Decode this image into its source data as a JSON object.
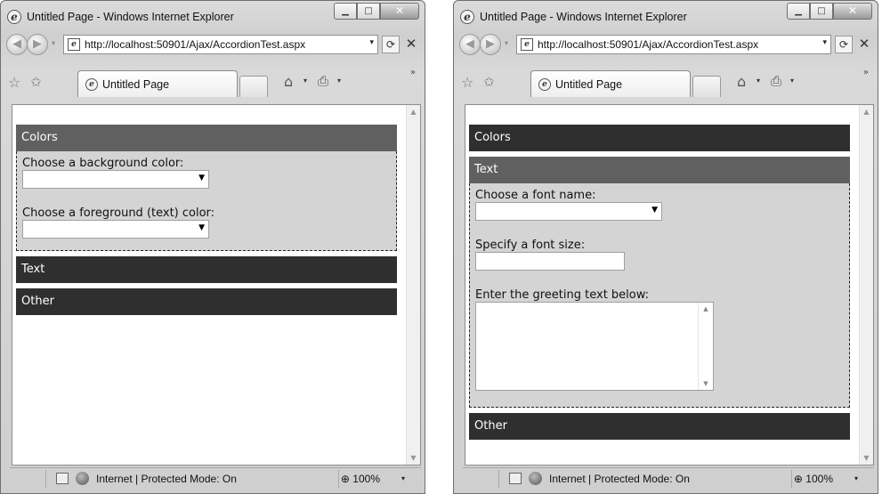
{
  "windows": [
    {
      "title": "Untitled Page - Windows Internet Explorer",
      "address": "http://localhost:50901/Ajax/AccordionTest.aspx",
      "tab_label": "Untitled Page",
      "accordion": {
        "colors_header": "Colors",
        "colors_bg_label": "Choose a background color:",
        "colors_fg_label": "Choose a foreground (text) color:",
        "text_header": "Text",
        "other_header": "Other",
        "open_pane": "Colors"
      },
      "status_text": "Internet | Protected Mode: On",
      "zoom": "100%"
    },
    {
      "title": "Untitled Page - Windows Internet Explorer",
      "address": "http://localhost:50901/Ajax/AccordionTest.aspx",
      "tab_label": "Untitled Page",
      "accordion": {
        "colors_header": "Colors",
        "text_header": "Text",
        "text_font_name_label": "Choose a font name:",
        "text_font_size_label": "Specify a font size:",
        "text_greeting_label": "Enter the greeting text below:",
        "other_header": "Other",
        "open_pane": "Text"
      },
      "status_text": "Internet | Protected Mode: On",
      "zoom": "100%"
    }
  ],
  "icons": {
    "back": "◀",
    "forward": "▶",
    "refresh": "⟳",
    "stop": "✕",
    "favorites": "☆",
    "add_favorites": "✩",
    "home": "⌂",
    "print": "⎙",
    "more": "»",
    "dropdown": "▾",
    "minimize": "▁",
    "maximize": "□",
    "close": "✕"
  },
  "colors": {
    "header_active": "#606060",
    "header_inactive": "#2f2f2f",
    "pane_bg": "#d4d4d4"
  }
}
